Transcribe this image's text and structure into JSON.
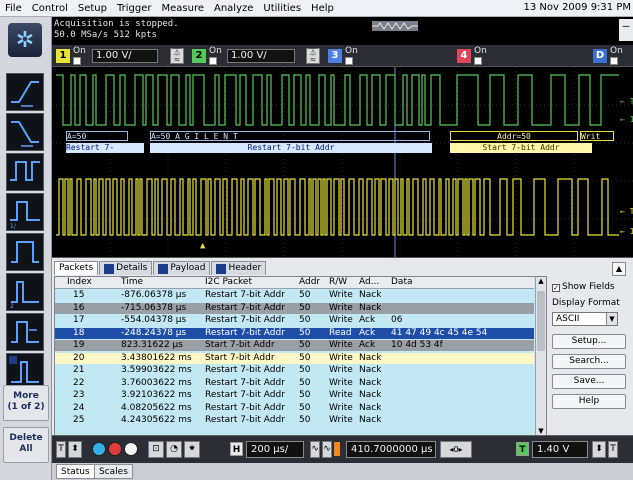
{
  "menu": [
    "File",
    "Control",
    "Setup",
    "Trigger",
    "Measure",
    "Analyze",
    "Utilities",
    "Help"
  ],
  "datetime": "13 Nov 2009  9:31 PM",
  "acquisition": {
    "line1": "Acquisition is stopped.",
    "line2": "50.0 MSa/s   512 kpts"
  },
  "channels": [
    {
      "num": "1",
      "on": "On",
      "value": "1.00 V/",
      "color": "#e8e23a"
    },
    {
      "num": "2",
      "on": "On",
      "value": "1.00 V/",
      "color": "#57c95b"
    },
    {
      "num": "3",
      "on": "On",
      "value": "",
      "color": "#4f7fe0"
    },
    {
      "num": "4",
      "on": "On",
      "value": "",
      "color": "#e0465a"
    },
    {
      "num": "D",
      "on": "On",
      "value": "",
      "color": "#3b6fd1"
    }
  ],
  "left_toolbar": {
    "more_line1": "More",
    "more_line2": "(1 of 2)",
    "delete_line1": "Delete",
    "delete_line2": "All"
  },
  "decode_annotations": {
    "row1_left": "A=50",
    "row1_mid": "A=50  A  G  I  L  E  N  T",
    "row1_right": "Addr=50",
    "row1_right_tag": "Writ",
    "row2_left": "Restart 7-",
    "row2_mid": "Restart 7-bit Addr",
    "row2_right": "Start 7-bit Addr"
  },
  "side_markers": {
    "green_top": "← T",
    "green_bottom": "← 1",
    "yellow_top": "← T",
    "yellow_bottom": "← 1"
  },
  "tabs": [
    "Packets",
    "Details",
    "Payload",
    "Header"
  ],
  "table": {
    "columns": [
      "Index",
      "Time",
      "I2C Packet",
      "Addr",
      "R/W",
      "Ad...",
      "Data"
    ],
    "rows": [
      {
        "index": "15",
        "time": "-876.06378 µs",
        "packet": "Restart 7-bit Addr",
        "addr": "50",
        "rw": "Write",
        "ack": "Nack",
        "data": "",
        "style": "normal"
      },
      {
        "index": "16",
        "time": "-715.06378 µs",
        "packet": "Restart 7-bit Addr",
        "addr": "50",
        "rw": "Write",
        "ack": "Nack",
        "data": "",
        "style": "gray"
      },
      {
        "index": "17",
        "time": "-554.04378 µs",
        "packet": "Restart 7-bit Addr",
        "addr": "50",
        "rw": "Write",
        "ack": "Ack",
        "data": "06",
        "style": "normal"
      },
      {
        "index": "18",
        "time": "-248.24378 µs",
        "packet": "Restart 7-bit Addr",
        "addr": "50",
        "rw": "Read",
        "ack": "Ack",
        "data": "41 47 49 4c 45 4e 54",
        "style": "sel"
      },
      {
        "index": "19",
        "time": "823.31622 µs",
        "packet": "Start 7-bit Addr",
        "addr": "50",
        "rw": "Write",
        "ack": "Ack",
        "data": "10 4d 53 4f",
        "style": "gray"
      },
      {
        "index": "20",
        "time": "3.43801622 ms",
        "packet": "Start 7-bit Addr",
        "addr": "50",
        "rw": "Write",
        "ack": "Nack",
        "data": "",
        "style": "yellow"
      },
      {
        "index": "21",
        "time": "3.59903622 ms",
        "packet": "Restart 7-bit Addr",
        "addr": "50",
        "rw": "Write",
        "ack": "Nack",
        "data": "",
        "style": "normal"
      },
      {
        "index": "22",
        "time": "3.76003622 ms",
        "packet": "Restart 7-bit Addr",
        "addr": "50",
        "rw": "Write",
        "ack": "Nack",
        "data": "",
        "style": "normal"
      },
      {
        "index": "23",
        "time": "3.92103622 ms",
        "packet": "Restart 7-bit Addr",
        "addr": "50",
        "rw": "Write",
        "ack": "Nack",
        "data": "",
        "style": "normal"
      },
      {
        "index": "24",
        "time": "4.08205622 ms",
        "packet": "Restart 7-bit Addr",
        "addr": "50",
        "rw": "Write",
        "ack": "Nack",
        "data": "",
        "style": "normal"
      },
      {
        "index": "25",
        "time": "4.24305622 ms",
        "packet": "Restart 7-bit Addr",
        "addr": "50",
        "rw": "Write",
        "ack": "Nack",
        "data": "",
        "style": "normal"
      }
    ]
  },
  "right_panel": {
    "show_fields": "Show Fields",
    "display_format_label": "Display Format",
    "display_format_value": "ASCII",
    "setup": "Setup...",
    "search": "Search...",
    "save": "Save...",
    "help": "Help"
  },
  "bottom_bar": {
    "timebase": "200 µs/",
    "delay": "410.7000000 µs",
    "trigger_level": "1.40 V",
    "h_label": "H",
    "t_label": "T"
  },
  "status_tabs": [
    "Status",
    "Scales"
  ]
}
